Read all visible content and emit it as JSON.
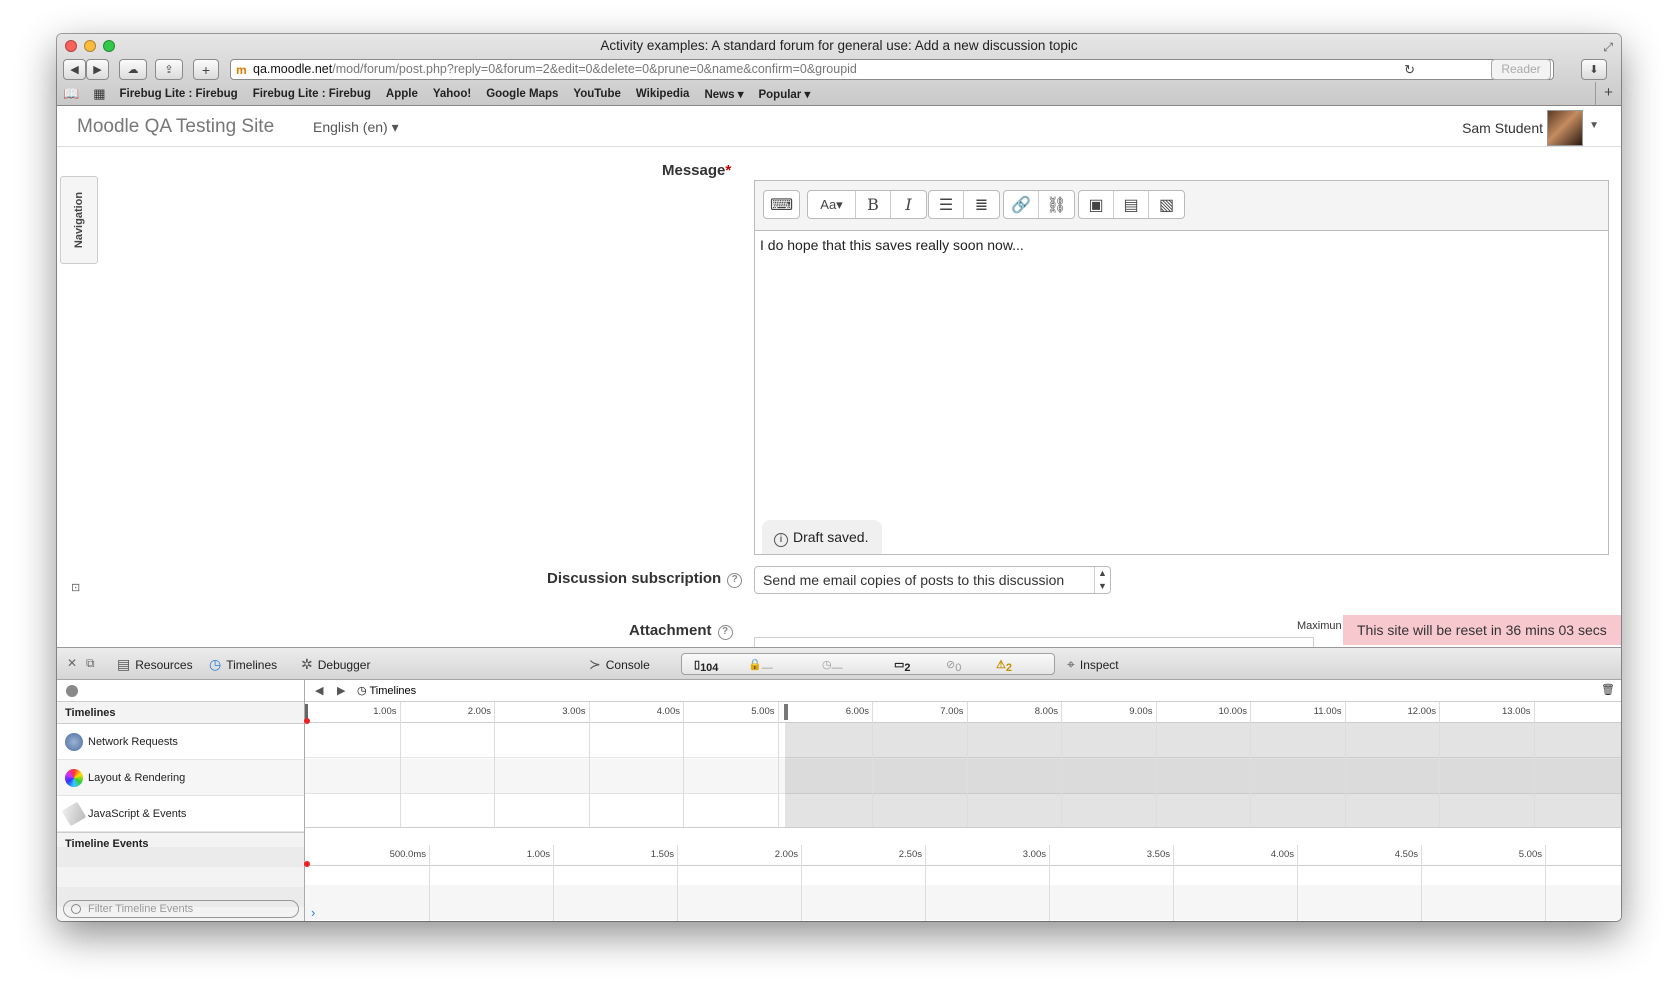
{
  "window": {
    "title": "Activity examples: A standard forum for general use: Add a new discussion topic",
    "url_host": "qa.moodle.net",
    "url_path": "/mod/forum/post.php?reply=0&forum=2&edit=0&delete=0&prune=0&name&confirm=0&groupid",
    "reader_label": "Reader",
    "traffic_colors": [
      "#fc605b",
      "#fdbc40",
      "#34c84a"
    ]
  },
  "bookmarks": [
    "Firebug Lite : Firebug",
    "Firebug Lite : Firebug",
    "Apple",
    "Yahoo!",
    "Google Maps",
    "YouTube",
    "Wikipedia",
    "News ▾",
    "Popular ▾"
  ],
  "site": {
    "name": "Moodle QA Testing Site",
    "language": "English (en) ▾",
    "user": "Sam Student",
    "nav_label": "Navigation"
  },
  "form": {
    "message_label": "Message",
    "required_mark": "*",
    "message_text": "I do hope that this saves really soon now...",
    "draft_status": "Draft saved.",
    "subscription_label": "Discussion subscription",
    "subscription_value": "Send me email copies of posts to this discussion",
    "attachment_label": "Attachment",
    "maximum_label": "Maximun"
  },
  "notice": {
    "reset_text": "This site will be reset in 36 mins 03 secs",
    "color": "#f7c9cf"
  },
  "devtools": {
    "tabs": [
      "Resources",
      "Timelines",
      "Debugger",
      "Console",
      "Inspect"
    ],
    "resource_count": "104",
    "lock_count": "—",
    "time_value": "—",
    "log_count": "2",
    "error_count": "0",
    "warning_count": "2",
    "breadcrumb": "Timelines",
    "timelines_header": "Timelines",
    "timeline_rows": [
      "Network Requests",
      "Layout & Rendering",
      "JavaScript & Events"
    ],
    "events_header": "Timeline Events",
    "filter_placeholder": "Filter Timeline Events",
    "overview_ticks": [
      "1.00s",
      "2.00s",
      "3.00s",
      "4.00s",
      "5.00s",
      "6.00s",
      "7.00s",
      "8.00s",
      "9.00s",
      "10.00s",
      "11.00s",
      "12.00s",
      "13.00s"
    ],
    "event_ticks": [
      "500.0ms",
      "1.00s",
      "1.50s",
      "2.00s",
      "2.50s",
      "3.00s",
      "3.50s",
      "4.00s",
      "4.50s",
      "5.00s"
    ]
  }
}
